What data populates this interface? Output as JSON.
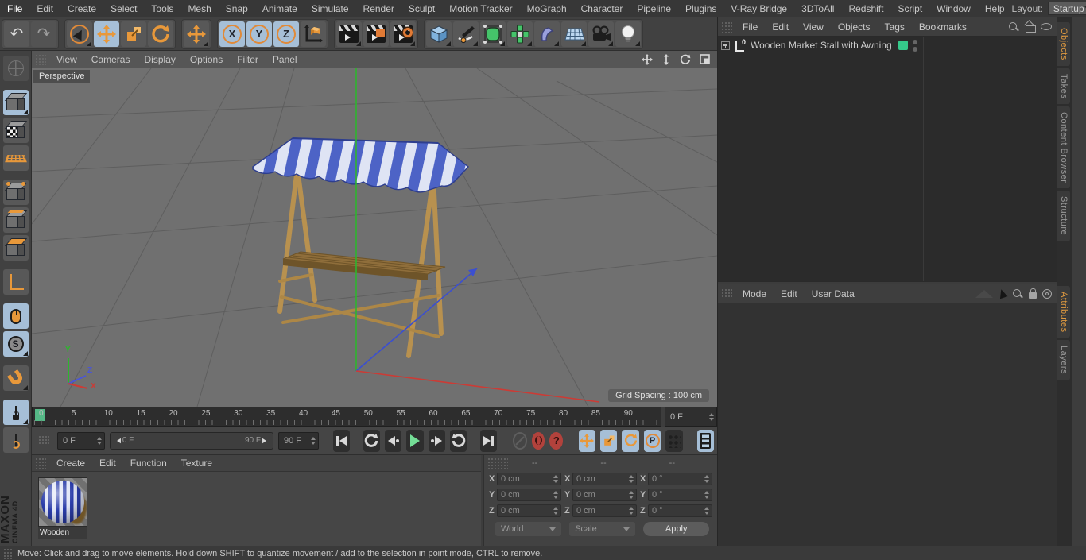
{
  "menubar": {
    "items": [
      "File",
      "Edit",
      "Create",
      "Select",
      "Tools",
      "Mesh",
      "Snap",
      "Animate",
      "Simulate",
      "Render",
      "Sculpt",
      "Motion Tracker",
      "MoGraph",
      "Character",
      "Pipeline",
      "Plugins",
      "V-Ray Bridge",
      "3DToAll",
      "Redshift",
      "Script",
      "Window",
      "Help"
    ],
    "layout_label": "Layout:",
    "layout_value": "Startup"
  },
  "glyphs": {
    "undo": "↶",
    "redo": "↷",
    "x": "X",
    "y": "Y",
    "z": "Z",
    "s": "S",
    "p": "P",
    "question": "?",
    "zero": "0"
  },
  "viewport": {
    "menu": [
      "View",
      "Cameras",
      "Display",
      "Options",
      "Filter",
      "Panel"
    ],
    "camera_label": "Perspective",
    "grid_spacing_label": "Grid Spacing : 100 cm",
    "axis_labels": {
      "x": "X",
      "y": "Y",
      "z": "Z"
    }
  },
  "objects_panel": {
    "menu": [
      "File",
      "Edit",
      "View",
      "Objects",
      "Tags",
      "Bookmarks"
    ],
    "items": [
      {
        "label": "Wooden Market Stall with Awning",
        "layer_color": "#35c98a"
      }
    ]
  },
  "right_tabs_top": [
    "Objects",
    "Takes",
    "Content Browser",
    "Structure"
  ],
  "right_tabs_bottom": [
    "Attributes",
    "Layers"
  ],
  "attributes_panel": {
    "menu": [
      "Mode",
      "Edit",
      "User Data"
    ]
  },
  "timeline": {
    "tick_labels": [
      "0",
      "5",
      "10",
      "15",
      "20",
      "25",
      "30",
      "35",
      "40",
      "45",
      "50",
      "55",
      "60",
      "65",
      "70",
      "75",
      "80",
      "85",
      "90"
    ],
    "frame_field": "0 F",
    "current_frame_field": "0 F",
    "range_start": "0 F",
    "range_end": "90 F",
    "end_field": "90 F"
  },
  "coordinates": {
    "section_headers": [
      "--",
      "--",
      "--"
    ],
    "groups": [
      {
        "rows": [
          {
            "axis": "X",
            "value": "0 cm"
          },
          {
            "axis": "Y",
            "value": "0 cm"
          },
          {
            "axis": "Z",
            "value": "0 cm"
          }
        ],
        "dropdown": "World"
      },
      {
        "rows": [
          {
            "axis": "X",
            "value": "0 cm"
          },
          {
            "axis": "Y",
            "value": "0 cm"
          },
          {
            "axis": "Z",
            "value": "0 cm"
          }
        ],
        "dropdown": "Scale"
      },
      {
        "rows": [
          {
            "axis": "X",
            "value": "0 °"
          },
          {
            "axis": "Y",
            "value": "0 °"
          },
          {
            "axis": "Z",
            "value": "0 °"
          }
        ],
        "apply_label": "Apply"
      }
    ]
  },
  "materials_panel": {
    "menu": [
      "Create",
      "Edit",
      "Function",
      "Texture"
    ],
    "materials": [
      {
        "name": "Wooden"
      }
    ]
  },
  "status_bar": {
    "text": "Move: Click and drag to move elements. Hold down SHIFT to quantize movement / add to the selection in point mode, CTRL to remove."
  },
  "branding": {
    "line1": "MAXON",
    "line2": "CINEMA 4D"
  },
  "colors": {
    "accent_orange": "#e8983a",
    "highlight_blue": "#a6bfd7",
    "viewport_bg": "#707070",
    "axis_green": "#2eb52e",
    "axis_red": "#cc3b35",
    "axis_blue": "#3b4fd0",
    "object_layer_green": "#35c98a",
    "awning_blue": "#4d63c6",
    "awning_white": "#dfe4f4",
    "wood_light": "#b8914f",
    "wood_dark": "#8f6e3b",
    "play_green": "#74dd96",
    "record_red": "#b2423c"
  }
}
